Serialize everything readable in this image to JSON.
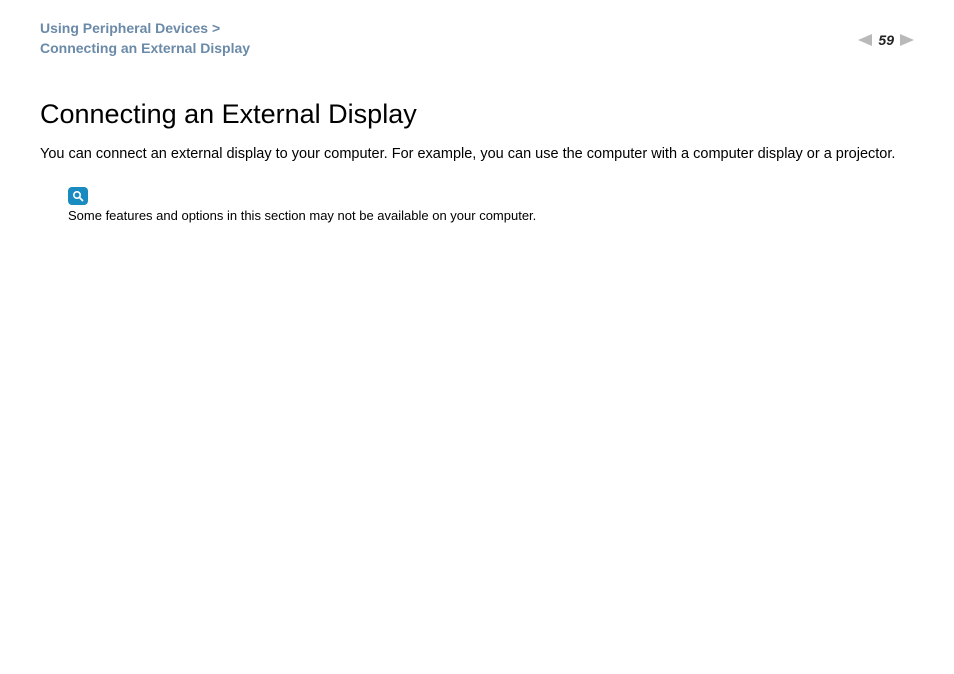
{
  "header": {
    "breadcrumb": {
      "parent": "Using Peripheral Devices",
      "separator": ">",
      "current": "Connecting an External Display"
    },
    "page_number": "59"
  },
  "content": {
    "title": "Connecting an External Display",
    "intro": "You can connect an external display to your computer. For example, you can use the computer with a computer display or a projector.",
    "note_text": "Some features and options in this section may not be available on your computer."
  }
}
